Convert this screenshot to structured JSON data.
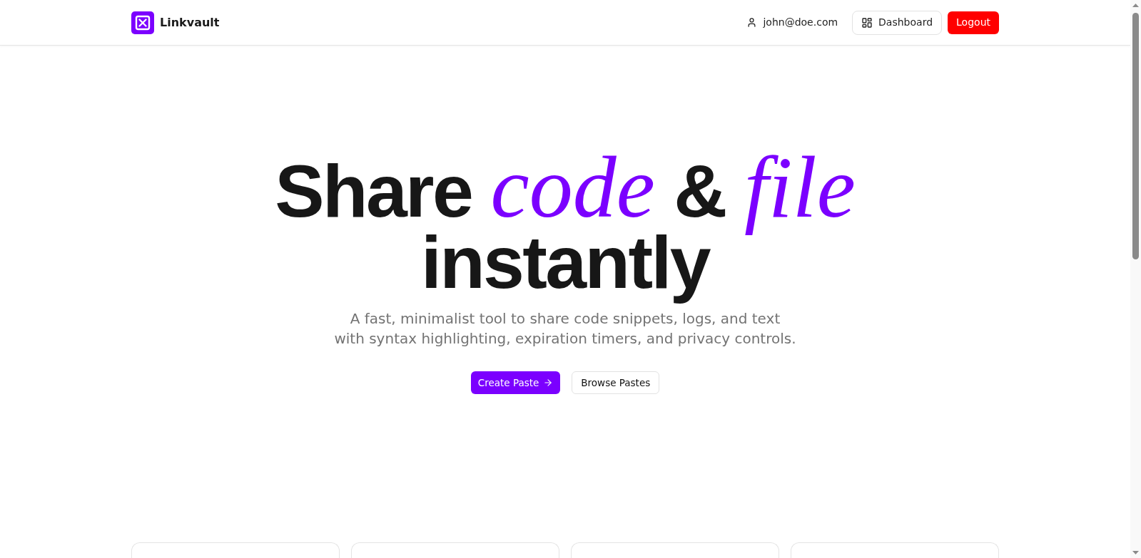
{
  "header": {
    "brand": "Linkvault",
    "user_email": "john@doe.com",
    "actions": [
      {
        "label": "Dashboard",
        "kind": "outline"
      },
      {
        "label": "Logout",
        "kind": "danger"
      }
    ]
  },
  "hero": {
    "headline": [
      [
        {
          "text": "Share",
          "kind": "plain"
        },
        {
          "text": "code",
          "kind": "accent"
        },
        {
          "text": "&",
          "kind": "plain"
        },
        {
          "text": "file",
          "kind": "accent"
        }
      ],
      [
        {
          "text": "instantly",
          "kind": "plain"
        }
      ]
    ],
    "subtitle_lines": [
      "A fast, minimalist tool to share code snippets, logs, and text",
      "with syntax highlighting, expiration timers, and privacy controls."
    ],
    "buttons": [
      {
        "label": "Create Paste",
        "kind": "primary"
      },
      {
        "label": "Browse Pastes",
        "kind": "outline"
      }
    ]
  }
}
